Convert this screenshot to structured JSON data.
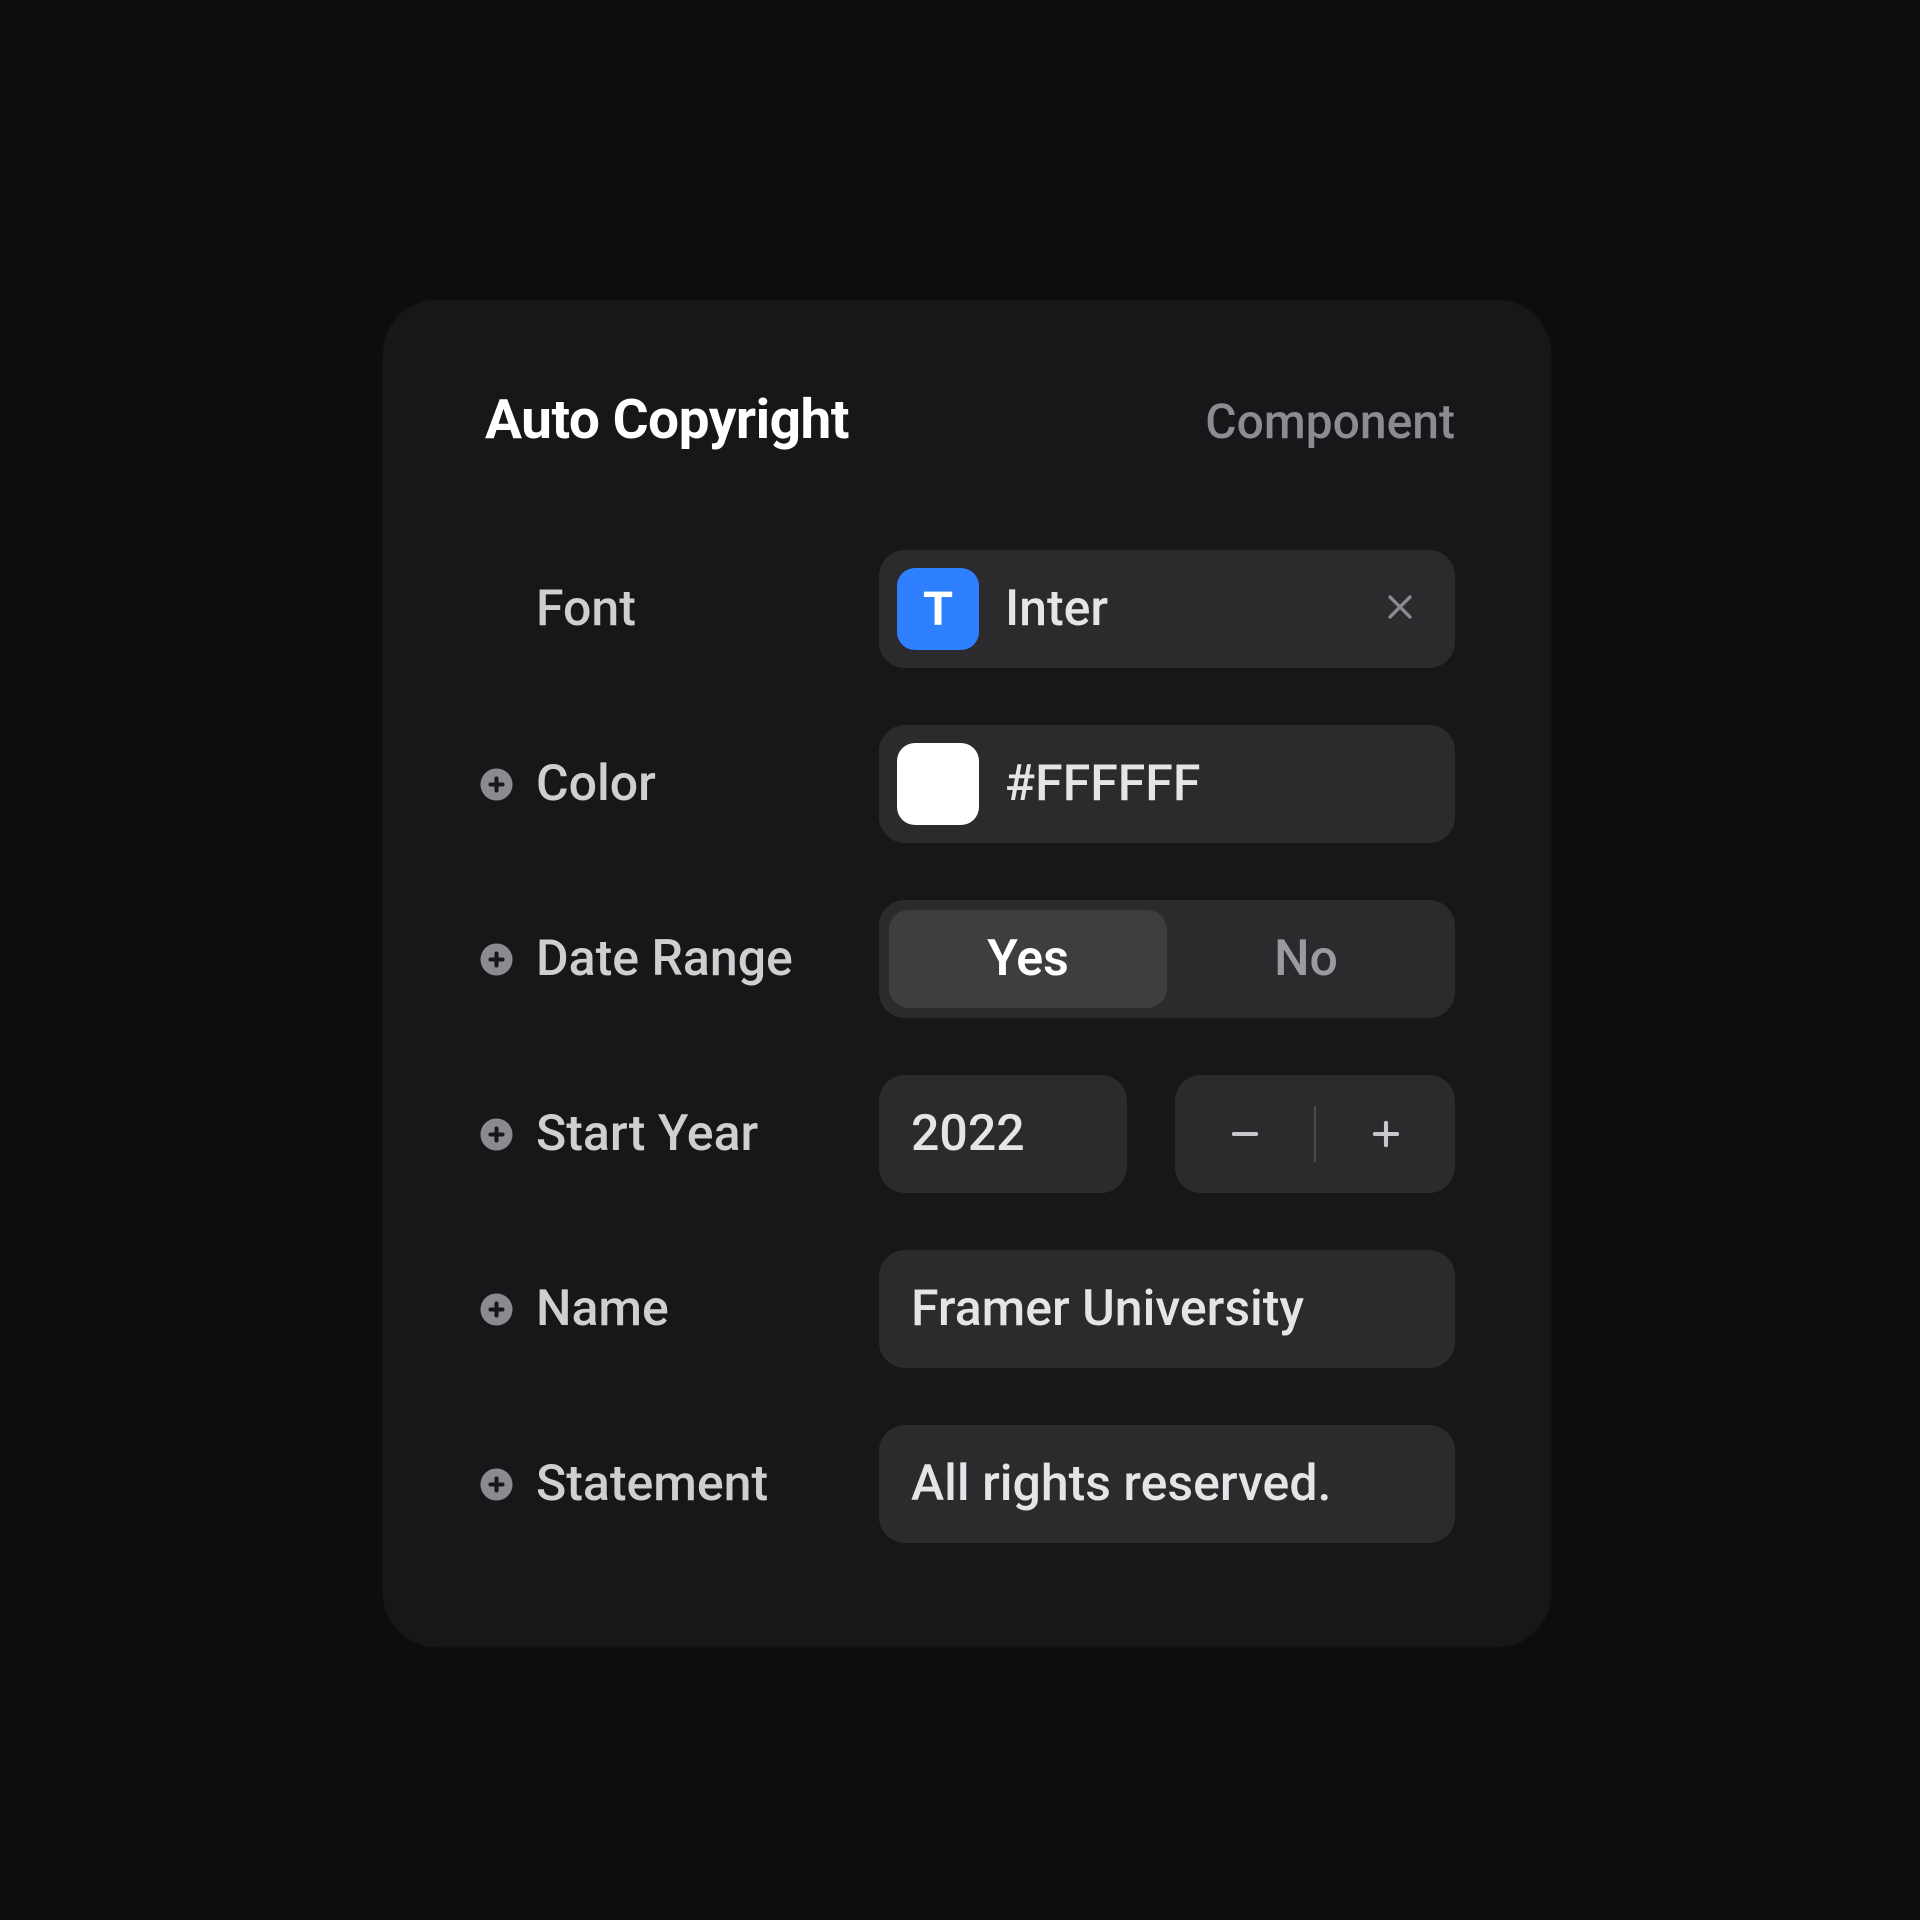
{
  "header": {
    "title": "Auto Copyright",
    "subtitle": "Component"
  },
  "fontIcon": "T",
  "fields": {
    "font": {
      "label": "Font",
      "value": "Inter"
    },
    "color": {
      "label": "Color",
      "value": "#FFFFFF",
      "swatch": "#FFFFFF"
    },
    "dateRange": {
      "label": "Date Range",
      "yes": "Yes",
      "no": "No",
      "active": "yes"
    },
    "startYear": {
      "label": "Start Year",
      "value": "2022"
    },
    "name": {
      "label": "Name",
      "value": "Framer University"
    },
    "statement": {
      "label": "Statement",
      "value": "All rights reserved."
    }
  }
}
